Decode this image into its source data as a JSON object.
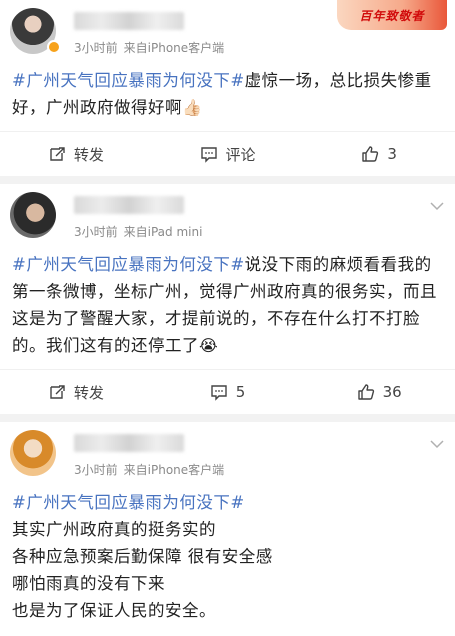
{
  "posts": [
    {
      "meta_time": "3小时前",
      "meta_source": "来自iPhone客户端",
      "promo_label": "百年致敬者",
      "hashtag": "#广州天气回应暴雨为何没下#",
      "text": "虚惊一场，总比损失惨重好，广州政府做得好啊",
      "emoji": "👍🏻",
      "actions": {
        "repost": "转发",
        "comment": "评论",
        "like": "3"
      }
    },
    {
      "meta_time": "3小时前",
      "meta_source": "来自iPad mini",
      "hashtag": "#广州天气回应暴雨为何没下#",
      "text": "说没下雨的麻烦看看我的第一条微博，坐标广州，觉得广州政府真的很务实，而且这是为了警醒大家，才提前说的，不存在什么打不打脸的。我们这有的还停工了",
      "emoji": "😭",
      "actions": {
        "repost": "转发",
        "comment": "5",
        "like": "36"
      }
    },
    {
      "meta_time": "3小时前",
      "meta_source": "来自iPhone客户端",
      "hashtag": "#广州天气回应暴雨为何没下#",
      "lines": [
        "其实广州政府真的挺务实的",
        "各种应急预案后勤保障 很有安全感",
        "哪怕雨真的没有下来",
        "也是为了保证人民的安全。"
      ]
    }
  ]
}
